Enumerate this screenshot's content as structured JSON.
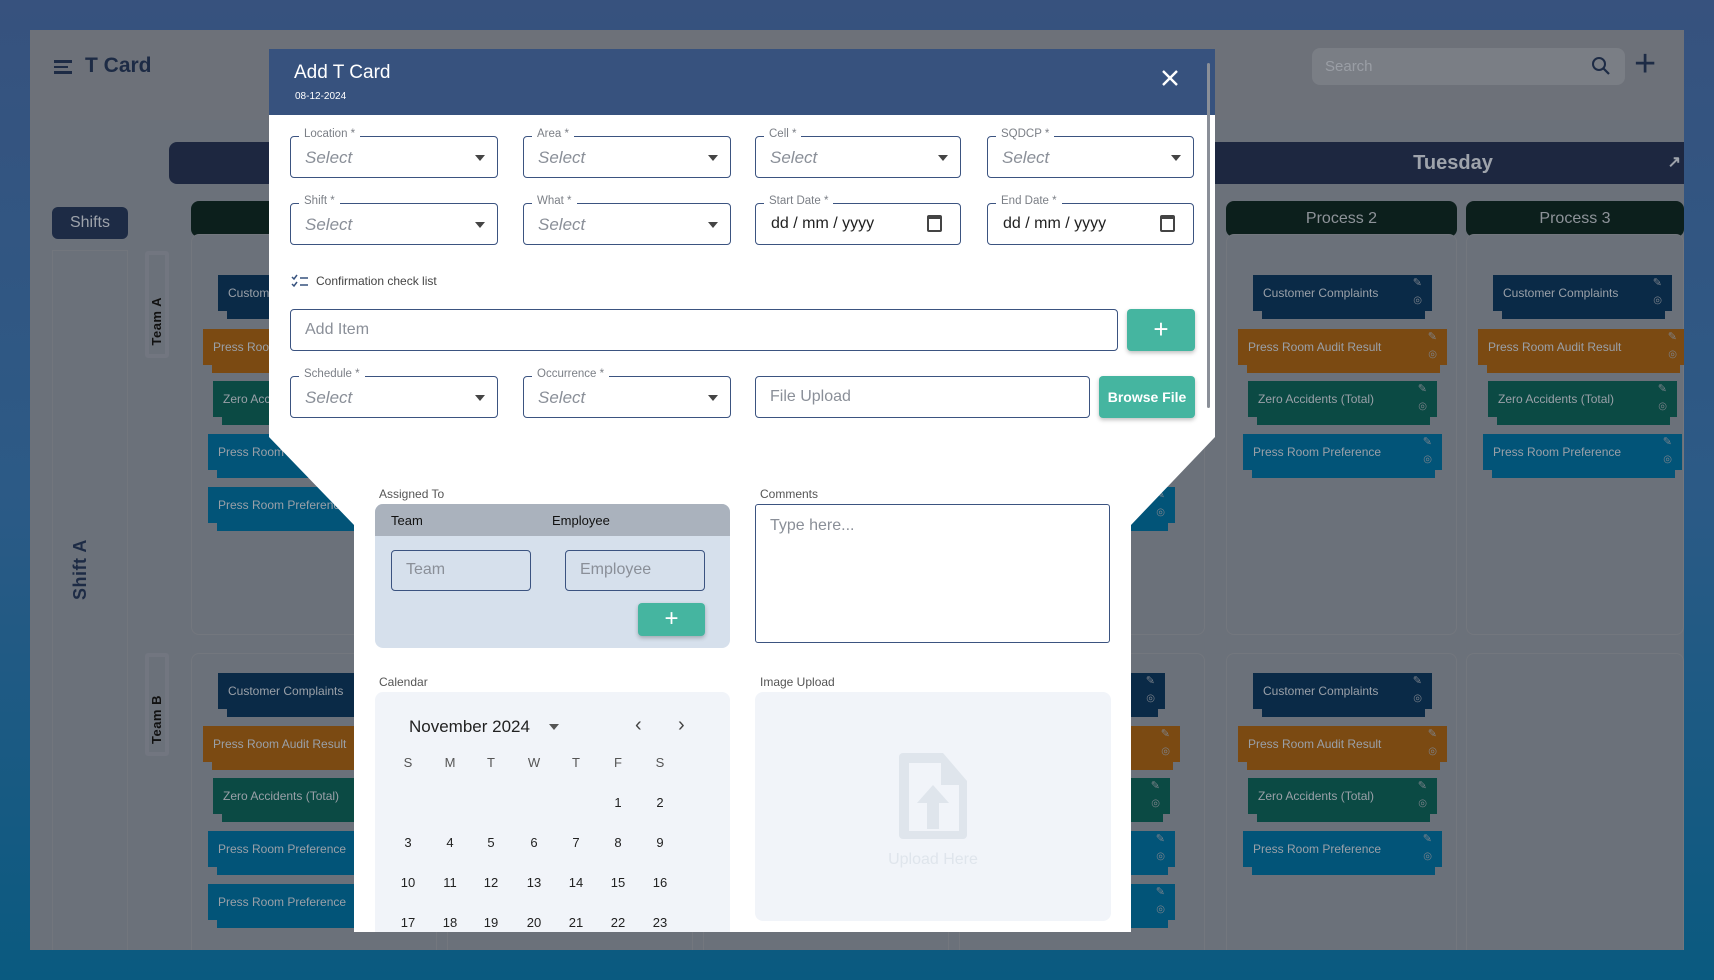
{
  "app": {
    "title": "T Card",
    "search_placeholder": "Search"
  },
  "board": {
    "shifts_label": "Shifts",
    "shift_name": "Shift A",
    "teams": [
      "Team A",
      "Team B"
    ],
    "days": [
      {
        "name": "",
        "processes": [
          "",
          "",
          "",
          ""
        ]
      },
      {
        "name": "Tuesday",
        "processes": [
          "Process 2",
          "Process 3"
        ]
      }
    ],
    "colors": {
      "navy": "#0a2a47",
      "orange": "#7b4a12",
      "teal": "#0b4a44",
      "blue": "#025478"
    },
    "columns": [
      {
        "team_a": [
          [
            "Customer Complaints",
            "navy"
          ],
          [
            "Press Room Audit Result",
            "orange"
          ],
          [
            "Zero Accidents (Total)",
            "teal"
          ],
          [
            "Press Room Preference",
            "blue"
          ],
          [
            "Press Room Preference",
            "blue"
          ]
        ],
        "team_b": [
          [
            "Customer Complaints",
            "navy"
          ],
          [
            "Press Room Audit Result",
            "orange"
          ],
          [
            "Zero Accidents (Total)",
            "teal"
          ],
          [
            "Press Room Preference",
            "blue"
          ],
          [
            "Press Room Preference",
            "blue"
          ]
        ]
      },
      {
        "team_a": [],
        "team_b": []
      },
      {
        "team_a": [],
        "team_b": []
      },
      {
        "team_a": [
          [
            "Customer Complaints",
            "navy"
          ],
          [
            "Press Room Audit Result",
            "orange"
          ],
          [
            "Zero Accidents (Total)",
            "teal"
          ],
          [
            "Press Room Preference",
            "blue"
          ],
          [
            "Press Room Preference",
            "blue"
          ]
        ],
        "team_b": [
          [
            "Customer Complaints",
            "navy"
          ],
          [
            "Press Room Audit Result",
            "orange"
          ],
          [
            "Zero Accidents (Total)",
            "teal"
          ],
          [
            "Press Room Preference",
            "blue"
          ],
          [
            "Press Room Preference",
            "blue"
          ]
        ]
      },
      {
        "team_a": [
          [
            "Customer Complaints",
            "navy"
          ],
          [
            "Press Room Audit Result",
            "orange"
          ],
          [
            "Zero Accidents (Total)",
            "teal"
          ],
          [
            "Press Room Preference",
            "blue"
          ]
        ],
        "team_b": [
          [
            "Customer Complaints",
            "navy"
          ],
          [
            "Press Room Audit Result",
            "orange"
          ],
          [
            "Zero Accidents (Total)",
            "teal"
          ],
          [
            "Press Room Preference",
            "blue"
          ]
        ]
      },
      {
        "team_a": [
          [
            "Customer Complaints",
            "navy"
          ],
          [
            "Press Room Audit Result",
            "orange"
          ],
          [
            "Zero Accidents (Total)",
            "teal"
          ],
          [
            "Press Room Preference",
            "blue"
          ]
        ],
        "team_b": []
      }
    ]
  },
  "modal": {
    "title": "Add T Card",
    "date": "08-12-2024",
    "fields": {
      "location": {
        "label": "Location *",
        "placeholder": "Select"
      },
      "area": {
        "label": "Area *",
        "placeholder": "Select"
      },
      "cell": {
        "label": "Cell *",
        "placeholder": "Select"
      },
      "sqdcp": {
        "label": "SQDCP *",
        "placeholder": "Select"
      },
      "shift": {
        "label": "Shift *",
        "placeholder": "Select"
      },
      "what": {
        "label": "What *",
        "placeholder": "Select"
      },
      "start_date": {
        "label": "Start Date *",
        "value": "dd / mm / yyyy"
      },
      "end_date": {
        "label": "End Date *",
        "value": "dd / mm / yyyy"
      },
      "schedule": {
        "label": "Schedule *",
        "placeholder": "Select"
      },
      "occurrence": {
        "label": "Occurrence *",
        "placeholder": "Select"
      }
    },
    "checklist_label": "Confirmation check list",
    "add_item_placeholder": "Add Item",
    "file_upload_placeholder": "File Upload",
    "browse_label": "Browse File",
    "assigned_to": {
      "label": "Assigned To",
      "col_team": "Team",
      "col_employee": "Employee",
      "team_placeholder": "Team",
      "employee_placeholder": "Employee"
    },
    "comments": {
      "label": "Comments",
      "placeholder": "Type here..."
    },
    "calendar": {
      "label": "Calendar",
      "month": "November 2024",
      "weekdays": [
        "S",
        "M",
        "T",
        "W",
        "T",
        "F",
        "S"
      ],
      "first_weekday": 5,
      "days_shown": 23
    },
    "image_upload": {
      "label": "Image Upload",
      "text": "Upload Here"
    }
  }
}
